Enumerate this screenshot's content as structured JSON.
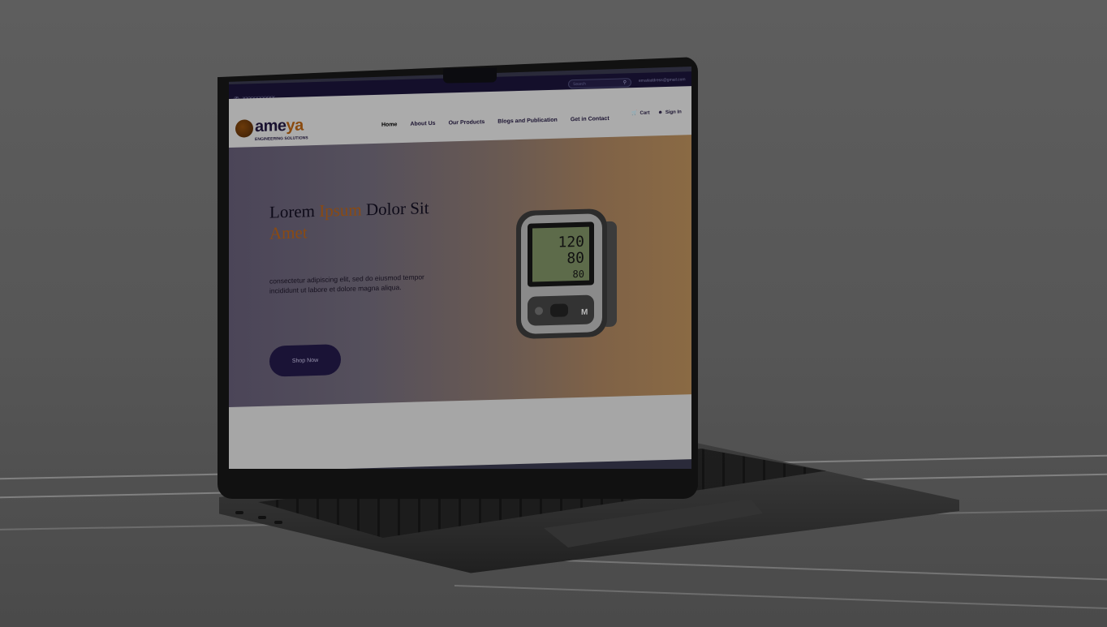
{
  "topbar": {
    "phone": "XXXXXXXXXX",
    "search_placeholder": "Search",
    "email": "emailaddress@gmail.com"
  },
  "brand": {
    "name_prefix": "ame",
    "name_accent": "ya",
    "tagline": "ENGINEERING SOLUTIONS"
  },
  "nav": {
    "items": [
      "Home",
      "About Us",
      "Our Products",
      "Blogs and Publication",
      "Get in Contact"
    ],
    "cart": "Cart",
    "signin": "Sign In"
  },
  "hero": {
    "title_1": "Lorem",
    "title_accent_1": "Ipsum",
    "title_2": "Dolor Sit",
    "title_accent_2": "Amet",
    "description": "consectetur adipiscing elit, sed do eiusmod tempor incididunt ut labore et dolore magna aliqua.",
    "button": "Shop Now"
  },
  "device_display": {
    "sys": "120",
    "dia": "80",
    "pulse": "80",
    "button_label": "M"
  },
  "colors": {
    "accent": "#8a4a12",
    "dark": "#140f2b",
    "nav_bg": "#ababab"
  }
}
